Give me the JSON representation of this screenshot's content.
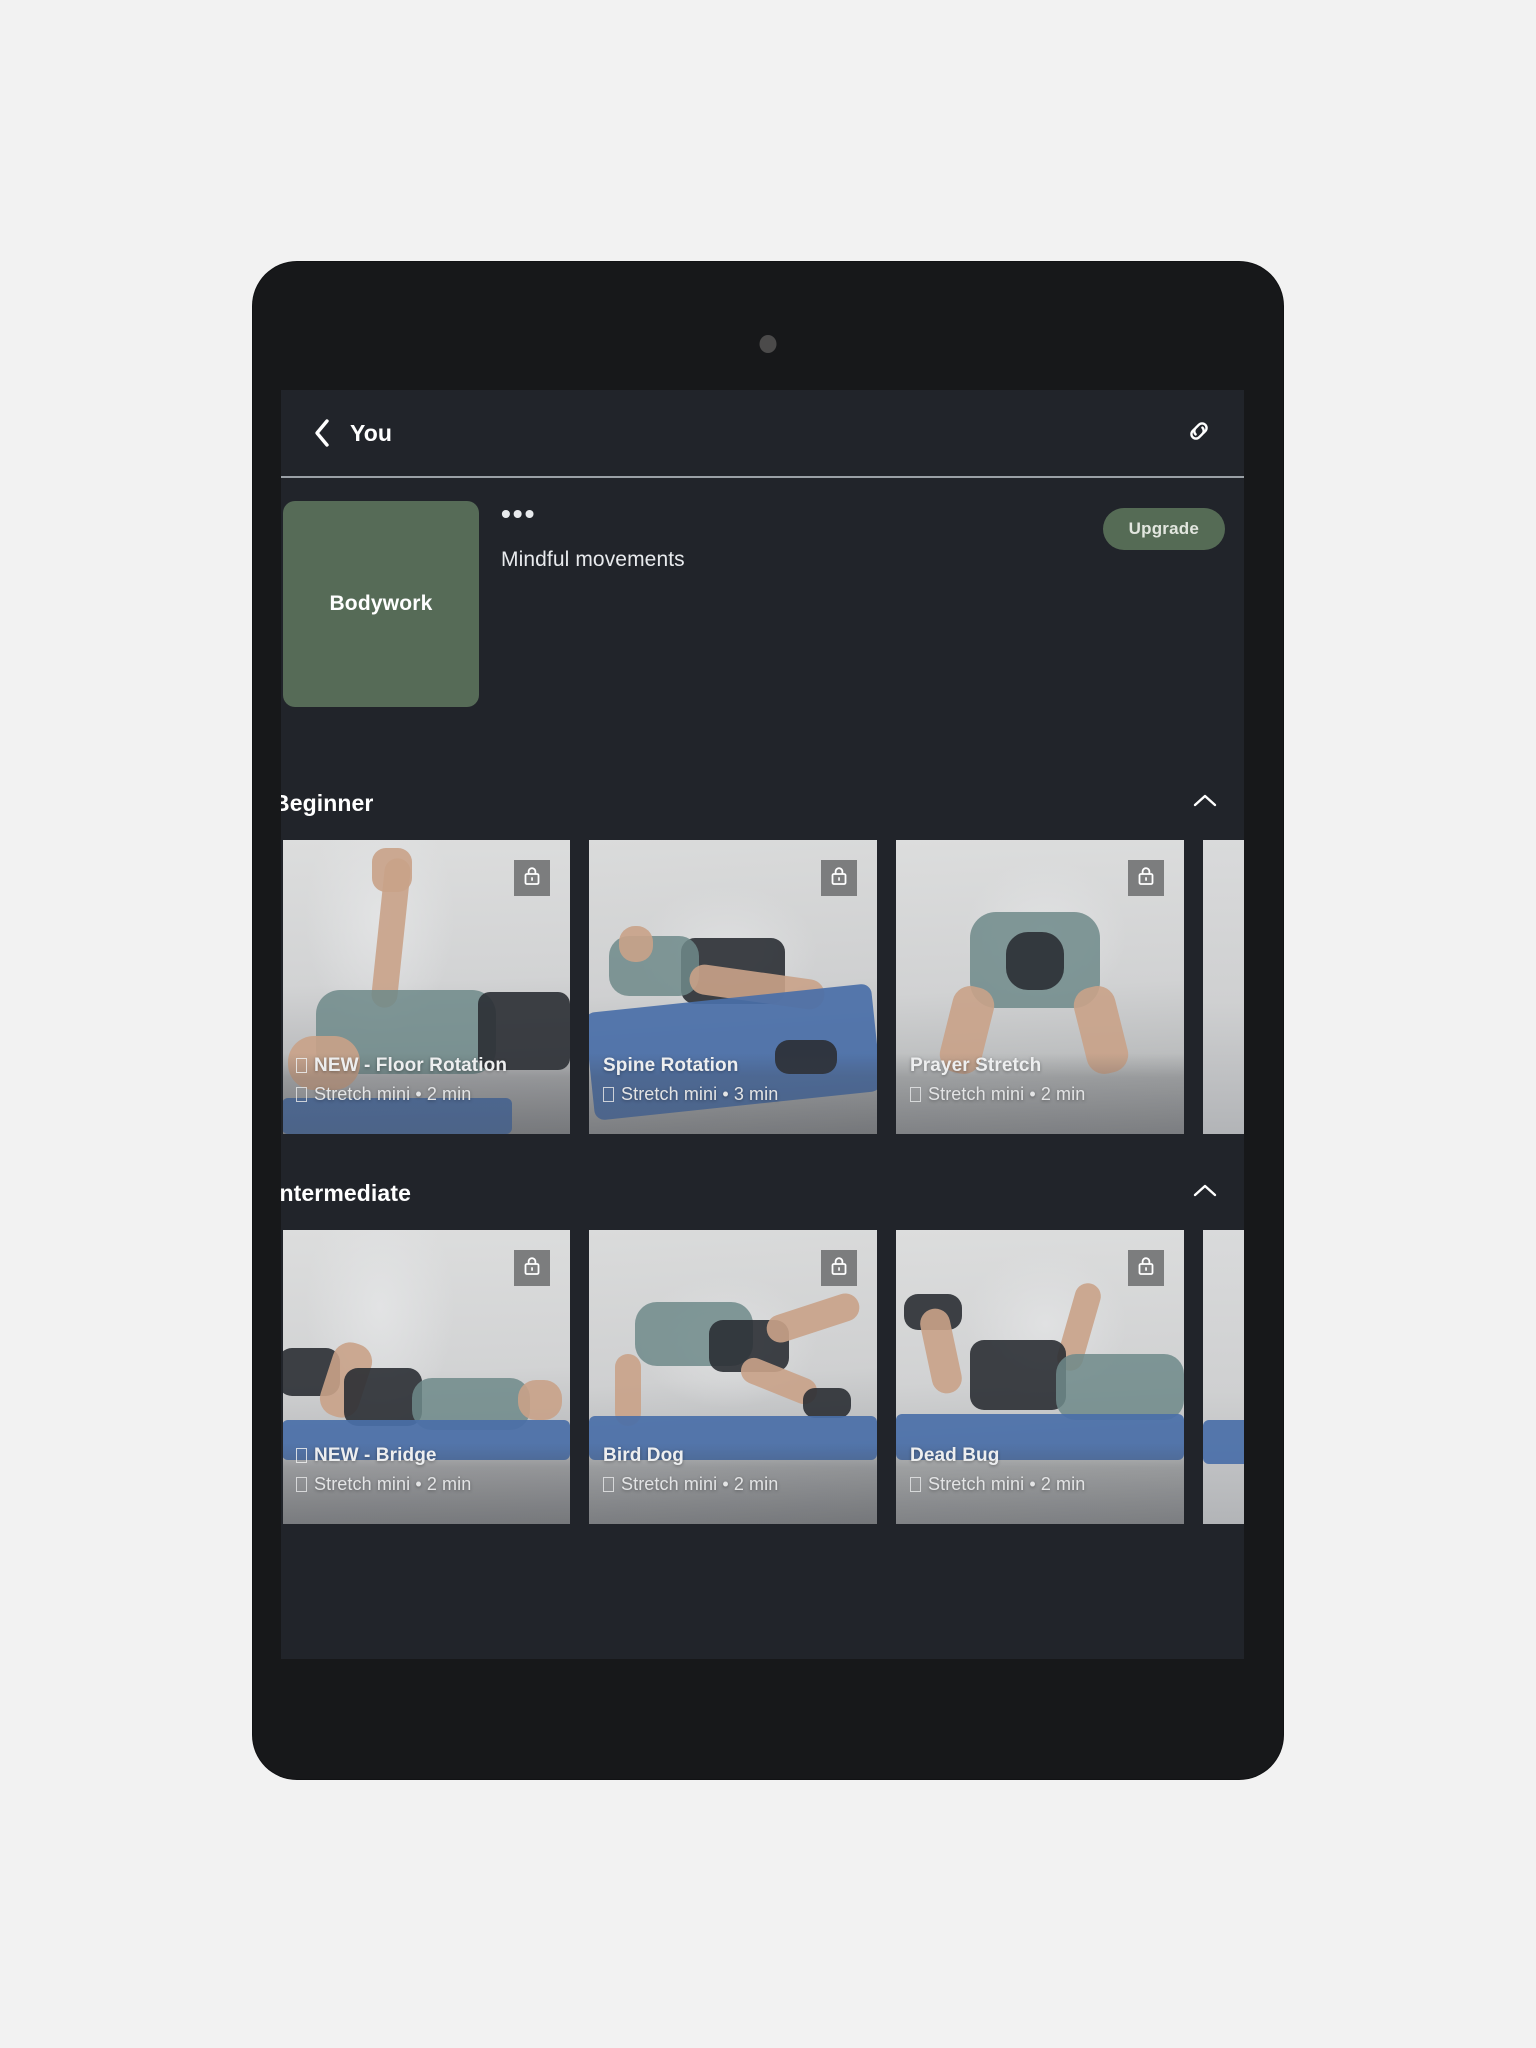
{
  "topbar": {
    "back_icon": "chevron-left-icon",
    "title": "You",
    "link_icon": "link-icon"
  },
  "program": {
    "thumb_label": "Bodywork",
    "thumb_color": "#566b57",
    "overflow_label": "•••",
    "subtitle": "Mindful movements",
    "upgrade_label": "Upgrade",
    "upgrade_color": "#556b55"
  },
  "sections": [
    {
      "title": "Beginner",
      "collapse_icon": "chevron-up-icon",
      "cards": [
        {
          "title": "NEW - Floor Rotation",
          "title_prefix_glyph": "missing-glyph",
          "subtitle": "Stretch mini • 2 min",
          "subtitle_prefix_glyph": "missing-glyph",
          "locked": true,
          "lock_icon": "lock-icon"
        },
        {
          "title": "Spine Rotation",
          "title_prefix_glyph": "",
          "subtitle": "Stretch mini • 3 min",
          "subtitle_prefix_glyph": "missing-glyph",
          "locked": true,
          "lock_icon": "lock-icon"
        },
        {
          "title": "Prayer Stretch",
          "title_prefix_glyph": "",
          "subtitle": "Stretch mini • 2 min",
          "subtitle_prefix_glyph": "missing-glyph",
          "locked": true,
          "lock_icon": "lock-icon"
        },
        {
          "title": "",
          "title_prefix_glyph": "",
          "subtitle": "",
          "subtitle_prefix_glyph": "",
          "locked": false,
          "lock_icon": ""
        }
      ]
    },
    {
      "title": "Intermediate",
      "collapse_icon": "chevron-up-icon",
      "cards": [
        {
          "title": "NEW - Bridge",
          "title_prefix_glyph": "missing-glyph",
          "subtitle": "Stretch mini • 2 min",
          "subtitle_prefix_glyph": "missing-glyph",
          "locked": true,
          "lock_icon": "lock-icon"
        },
        {
          "title": "Bird Dog",
          "title_prefix_glyph": "",
          "subtitle": "Stretch mini • 2 min",
          "subtitle_prefix_glyph": "missing-glyph",
          "locked": true,
          "lock_icon": "lock-icon"
        },
        {
          "title": "Dead Bug",
          "title_prefix_glyph": "",
          "subtitle": "Stretch mini • 2 min",
          "subtitle_prefix_glyph": "missing-glyph",
          "locked": true,
          "lock_icon": "lock-icon"
        },
        {
          "title": "",
          "title_prefix_glyph": "",
          "subtitle": "",
          "subtitle_prefix_glyph": "",
          "locked": false,
          "lock_icon": ""
        }
      ]
    }
  ],
  "theme": {
    "page_background": "#f2f2f2",
    "device_bezel": "#17181a",
    "screen_background": "#21242a",
    "text_primary": "#ffffff",
    "text_secondary": "#e8eaed",
    "divider": "#9aa0a6",
    "lock_badge": "#7c7d7e"
  }
}
